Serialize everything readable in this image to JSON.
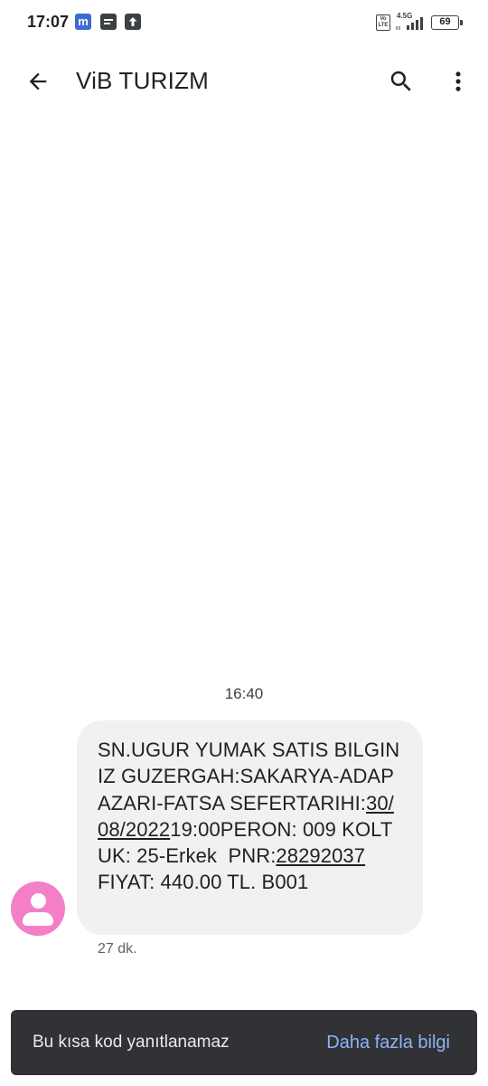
{
  "status_bar": {
    "time": "17:07",
    "m_badge": "m",
    "network": "4.5G",
    "volte_top": "Vo",
    "volte_bottom": "LTE",
    "battery": "69",
    "icons": [
      "m-app-icon",
      "message-notification-icon",
      "upload-icon",
      "volte-icon",
      "signal-icon",
      "battery-icon"
    ]
  },
  "app_bar": {
    "title": "ViB TURIZM",
    "icons": [
      "back-arrow-icon",
      "search-icon",
      "more-vert-icon"
    ]
  },
  "conversation": {
    "timestamp": "16:40",
    "message": {
      "part1": "SN.UGUR YUMAK SATIS BILGINIZ GUZERGAH:SAKARYA-ADAPAZARI-FATSA SEFERTARIHI:",
      "date_link": "30/08/2022",
      "part2": "19:00PERON: 009 KOLTUK: 25-Erkek  PNR:",
      "pnr_link": "28292037",
      "part3": "FIYAT: 440.00 TL. B001"
    },
    "age": "27 dk."
  },
  "snackbar": {
    "text": "Bu kısa kod yanıtlanamaz",
    "action": "Daha fazla bilgi"
  },
  "colors": {
    "avatar": "#f27fc8",
    "bubble": "#f1f1f1",
    "snackbar_bg": "#313235",
    "snackbar_action": "#8ab4f8"
  }
}
